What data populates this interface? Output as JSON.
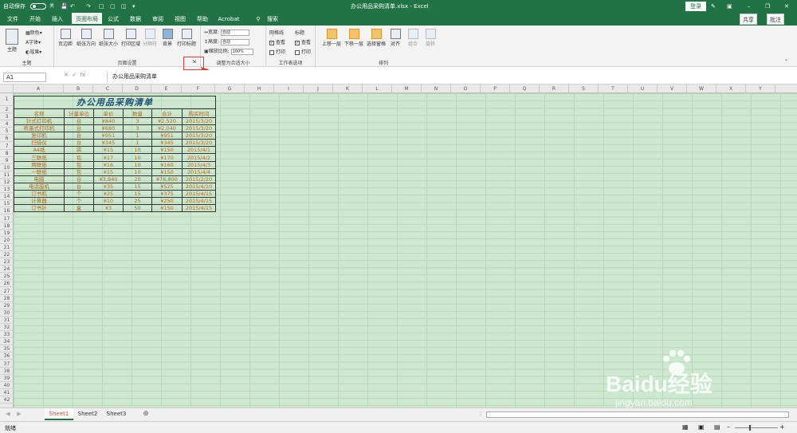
{
  "titlebar": {
    "autosave": "自动保存",
    "autosave_state": "关",
    "filename": "办公用品采购清单.xlsx - Excel",
    "login": "登录"
  },
  "tabs": [
    "文件",
    "开始",
    "插入",
    "页面布局",
    "公式",
    "数据",
    "审阅",
    "视图",
    "帮助",
    "Acrobat",
    "搜索"
  ],
  "active_tab": "页面布局",
  "share": "共享",
  "comment": "批注",
  "ribbon": {
    "theme": {
      "label": "主题",
      "btn": "主题",
      "colors": "颜色",
      "fonts": "字体",
      "effects": "效果"
    },
    "page_setup": {
      "label": "页面设置",
      "margins": "页边距",
      "orientation": "纸张方向",
      "size": "纸张大小",
      "print_area": "打印区域",
      "breaks": "分隔符",
      "background": "背景",
      "print_titles": "打印标题"
    },
    "scale": {
      "label": "调整为合适大小",
      "width": "宽度:",
      "height": "高度:",
      "scale": "缩放比例:",
      "width_val": "自动",
      "height_val": "自动",
      "scale_val": "100%"
    },
    "sheet_opts": {
      "label": "工作表选项",
      "gridlines": "网格线",
      "headings": "标题",
      "view1": "查看",
      "print1": "打印",
      "view2": "查看",
      "print2": "打印"
    },
    "arrange": {
      "label": "排列",
      "forward": "上移一层",
      "backward": "下移一层",
      "selection": "选择窗格",
      "align": "对齐",
      "group": "组合",
      "rotate": "旋转"
    }
  },
  "formula_bar": {
    "namebox": "A1",
    "fx": "fx",
    "content": "办公用品采购清单"
  },
  "columns": [
    "A",
    "B",
    "C",
    "D",
    "E",
    "F",
    "G",
    "H",
    "I",
    "J",
    "K",
    "L",
    "M",
    "N",
    "O",
    "P",
    "Q",
    "R",
    "S",
    "T",
    "U",
    "V",
    "W",
    "X",
    "Y"
  ],
  "rows": [
    "1",
    "2",
    "3",
    "4",
    "5",
    "6",
    "7",
    "8",
    "9",
    "10",
    "11",
    "12",
    "13",
    "14",
    "15",
    "16",
    "17",
    "18",
    "19",
    "20",
    "21",
    "22",
    "23",
    "24",
    "25",
    "26",
    "27",
    "28",
    "29",
    "30",
    "31",
    "32",
    "33",
    "34",
    "35",
    "36",
    "37",
    "38",
    "39",
    "40",
    "41",
    "42"
  ],
  "table": {
    "title": "办公用品采购清单",
    "headers": [
      "名称",
      "计量单位",
      "单价",
      "数量",
      "合计",
      "购买时间"
    ],
    "rows": [
      [
        "针式打印机",
        "台",
        "¥840",
        "3",
        "¥2,520",
        "2015/3/20"
      ],
      [
        "喷墨式打印机",
        "台",
        "¥680",
        "3",
        "¥2,040",
        "2015/3/20"
      ],
      [
        "复印机",
        "台",
        "¥951",
        "1",
        "¥951",
        "2015/3/20"
      ],
      [
        "扫描仪",
        "台",
        "¥345",
        "1",
        "¥345",
        "2015/3/20"
      ],
      [
        "A4纸",
        "袋",
        "¥15",
        "10",
        "¥150",
        "2015/4/1"
      ],
      [
        "三联纸",
        "包",
        "¥17",
        "10",
        "¥170",
        "2015/4/2"
      ],
      [
        "两联纸",
        "包",
        "¥16",
        "10",
        "¥160",
        "2015/4/3"
      ],
      [
        "一联纸",
        "包",
        "¥15",
        "10",
        "¥150",
        "2015/4/4"
      ],
      [
        "电脑",
        "台",
        "¥3,840",
        "20",
        "¥76,800",
        "2015/2/20"
      ],
      [
        "电话座机",
        "台",
        "¥35",
        "15",
        "¥525",
        "2015/4/10"
      ],
      [
        "订书机",
        "个",
        "¥25",
        "15",
        "¥375",
        "2015/4/15"
      ],
      [
        "计算器",
        "个",
        "¥10",
        "25",
        "¥250",
        "2015/4/15"
      ],
      [
        "订书针",
        "盒",
        "¥3",
        "50",
        "¥150",
        "2015/4/15"
      ]
    ]
  },
  "sheets": [
    "Sheet1",
    "Sheet2",
    "Sheet3"
  ],
  "active_sheet": "Sheet1",
  "status": {
    "ready": "就绪"
  },
  "watermark": {
    "brand": "Baidu经验",
    "url": "jingyan.baidu.com"
  },
  "colors": {
    "excel_green": "#217346",
    "sheet_bg": "#cce8cf",
    "highlight": "#e53935",
    "cell_text": "#b5651d",
    "title_text": "#1f4e79"
  }
}
